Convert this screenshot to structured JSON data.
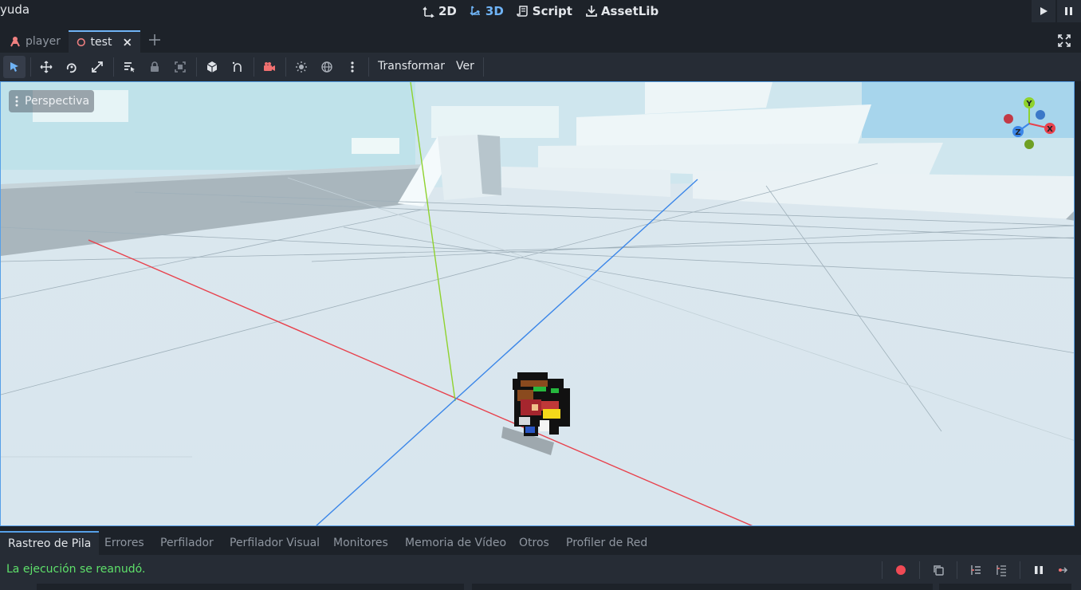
{
  "menu": {
    "fragment": "yuda"
  },
  "modes": [
    {
      "label": "2D",
      "icon": "2d-icon",
      "active": false
    },
    {
      "label": "3D",
      "icon": "3d-icon",
      "active": true
    },
    {
      "label": "Script",
      "icon": "script-icon",
      "active": false
    },
    {
      "label": "AssetLib",
      "icon": "assetlib-icon",
      "active": false
    }
  ],
  "tabs": [
    {
      "label": "player",
      "icon": "node-icon",
      "active": false
    },
    {
      "label": "test",
      "icon": "circle-icon",
      "active": true
    }
  ],
  "toolbar": {
    "menus": {
      "transform": "Transformar",
      "view": "Ver"
    }
  },
  "viewport": {
    "perspective_label": "Perspectiva",
    "gizmo": {
      "y": "Y",
      "x": "X",
      "z": "Z"
    }
  },
  "bottom_panel": {
    "tabs": [
      "Rastreo de Pila",
      "Errores",
      "Perfilador",
      "Perfilador Visual",
      "Monitores",
      "Memoria de Vídeo",
      "Otros",
      "Profiler de Red"
    ],
    "active_tab": "Rastreo de Pila",
    "status": "La ejecución se reanudó."
  },
  "colors": {
    "accent": "#6fb3f5",
    "status_ok": "#5ee06a",
    "axis_x": "#e8414c",
    "axis_y": "#8fd22e",
    "axis_z": "#3b86e8"
  }
}
